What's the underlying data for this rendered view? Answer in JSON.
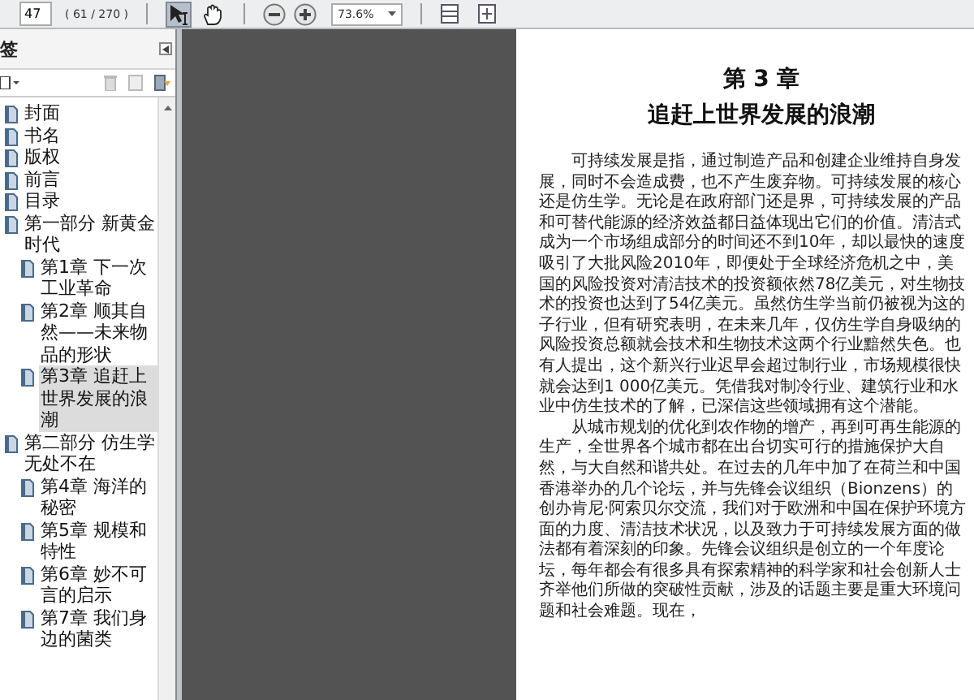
{
  "toolbar": {
    "page_number": "47",
    "page_count": "( 61 / 270 )",
    "zoom": "73.6%",
    "tools": [
      {
        "kind": "select",
        "selected": true
      },
      {
        "kind": "hand",
        "selected": false
      }
    ]
  },
  "bookmarks": {
    "title": "签",
    "items": [
      {
        "label": "封面",
        "selected": false
      },
      {
        "label": "书名",
        "selected": false
      },
      {
        "label": "版权",
        "selected": false
      },
      {
        "label": "前言",
        "selected": false
      },
      {
        "label": "目录",
        "selected": false
      },
      {
        "label": "第一部分 新黄金时代",
        "selected": false,
        "children": [
          {
            "label": "第1章 下一次工业革命",
            "selected": false
          },
          {
            "label": "第2章 顺其自然——未来物品的形状",
            "selected": false
          },
          {
            "label": "第3章 追赶上世界发展的浪潮",
            "selected": true
          }
        ]
      },
      {
        "label": "第二部分 仿生学无处不在",
        "selected": false,
        "children": [
          {
            "label": "第4章 海洋的秘密",
            "selected": false
          },
          {
            "label": "第5章 规模和特性",
            "selected": false
          },
          {
            "label": "第6章 妙不可言的启示",
            "selected": false
          },
          {
            "label": "第7章 我们身边的菌类",
            "selected": false
          }
        ]
      }
    ]
  },
  "page": {
    "chapter": "第 3 章",
    "title": "追赶上世界发展的浪潮",
    "paragraphs": [
      "可持续发展是指，通过制造产品和创建企业维持自身发展，同时不会造成费，也不产生废弃物。可持续发展的核心还是仿生学。无论是在政府部门还是界，可持续发展的产品和可替代能源的经济效益都日益体现出它们的价值。清洁式成为一个市场组成部分的时间还不到10年，却以最快的速度吸引了大批风险2010年，即便处于全球经济危机之中，美国的风险投资对清洁技术的投资额依然78亿美元，对生物技术的投资也达到了54亿美元。虽然仿生学当前仍被视为这的子行业，但有研究表明，在未来几年，仅仿生学自身吸纳的风险投资总额就会技术和生物技术这两个行业黯然失色。也有人提出，这个新兴行业迟早会超过制行业，市场规模很快就会达到1 000亿美元。凭借我对制冷行业、建筑行业和水业中仿生技术的了解，已深信这些领域拥有这个潜能。",
      "从城市规划的优化到农作物的增产，再到可再生能源的生产，全世界各个城市都在出台切实可行的措施保护大自然，与大自然和谐共处。在过去的几年中加了在荷兰和中国香港举办的几个论坛，并与先锋会议组织（Bionzens）的创办肯尼·阿索贝尔交流，我们对于欧洲和中国在保护环境方面的力度、清洁技术状况，以及致力于可持续发展方面的做法都有着深刻的印象。先锋会议组织是创立的一个年度论坛，每年都会有很多具有探索精神的科学家和社会创新人士齐举他们所做的突破性贡献，涉及的话题主要是重大环境问题和社会难题。现在，"
    ]
  }
}
